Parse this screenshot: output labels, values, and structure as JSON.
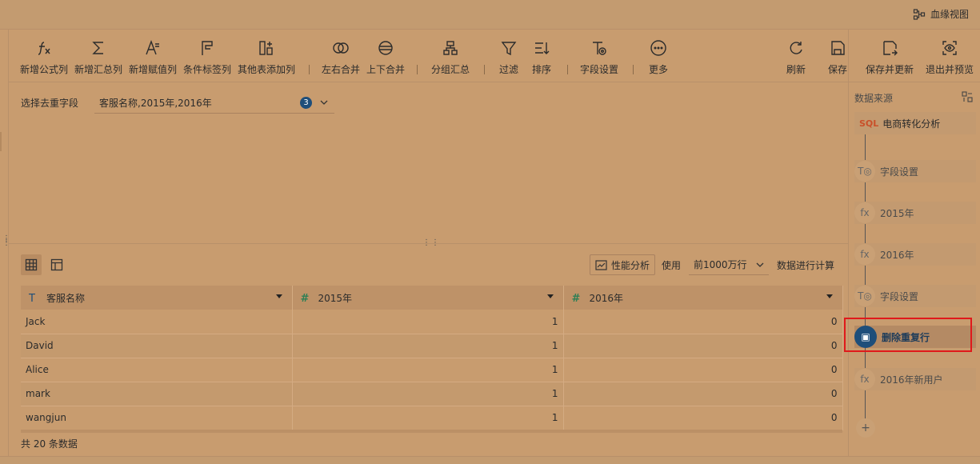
{
  "header": {
    "lineage_label": "血缘视图"
  },
  "toolbar": {
    "left": [
      {
        "label": "新增公式列",
        "icon": "formula-icon"
      },
      {
        "label": "新增汇总列",
        "icon": "sigma-icon"
      },
      {
        "label": "新增赋值列",
        "icon": "assign-icon"
      },
      {
        "label": "条件标签列",
        "icon": "flag-icon"
      },
      {
        "label": "其他表添加列",
        "icon": "add-column-icon"
      },
      {
        "label": "左右合并",
        "icon": "horizontal-merge-icon"
      },
      {
        "label": "上下合并",
        "icon": "vertical-merge-icon"
      },
      {
        "label": "分组汇总",
        "icon": "group-icon"
      },
      {
        "label": "过滤",
        "icon": "filter-icon"
      },
      {
        "label": "排序",
        "icon": "sort-icon"
      },
      {
        "label": "字段设置",
        "icon": "field-settings-icon"
      },
      {
        "label": "更多",
        "icon": "more-icon"
      }
    ],
    "right": [
      {
        "label": "刷新",
        "icon": "refresh-icon"
      },
      {
        "label": "保存",
        "icon": "save-icon"
      },
      {
        "label": "保存并更新",
        "icon": "save-update-icon"
      },
      {
        "label": "退出并预览",
        "icon": "preview-icon"
      }
    ]
  },
  "dedup": {
    "label": "选择去重字段",
    "value": "客服名称,2015年,2016年",
    "count": "3"
  },
  "preview": {
    "perf_label": "性能分析",
    "use_label": "使用",
    "rows_option": "前1000万行",
    "calc_label": "数据进行计算"
  },
  "table": {
    "columns": [
      {
        "name": "客服名称",
        "type": "T"
      },
      {
        "name": "2015年",
        "type": "#"
      },
      {
        "name": "2016年",
        "type": "#"
      }
    ],
    "rows": [
      [
        "Jack",
        "1",
        "0"
      ],
      [
        "David",
        "1",
        "0"
      ],
      [
        "Alice",
        "1",
        "0"
      ],
      [
        "mark",
        "1",
        "0"
      ],
      [
        "wangjun",
        "1",
        "0"
      ]
    ],
    "total_text": "共 20 条数据"
  },
  "sidebar": {
    "title": "数据来源",
    "source": {
      "tag": "SQL",
      "label": "电商转化分析"
    },
    "steps": [
      {
        "icon": "T◎",
        "label": "字段设置",
        "active": false
      },
      {
        "icon": "fx",
        "label": "2015年",
        "active": false
      },
      {
        "icon": "fx",
        "label": "2016年",
        "active": false
      },
      {
        "icon": "T◎",
        "label": "字段设置",
        "active": false
      },
      {
        "icon": "▣",
        "label": "删除重复行",
        "active": true
      },
      {
        "icon": "fx",
        "label": "2016年新用户",
        "active": false
      }
    ],
    "add_label": "+"
  }
}
